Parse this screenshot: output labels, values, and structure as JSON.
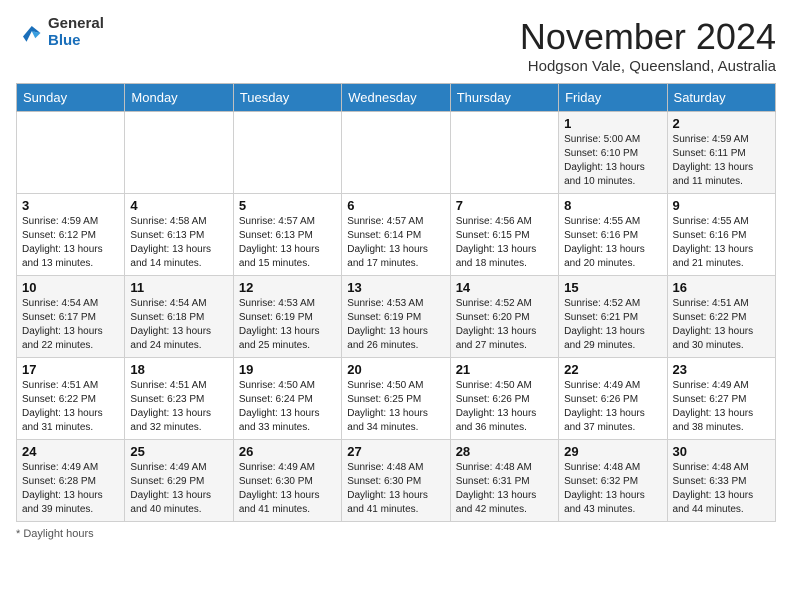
{
  "header": {
    "logo_line1": "General",
    "logo_line2": "Blue",
    "month_year": "November 2024",
    "location": "Hodgson Vale, Queensland, Australia"
  },
  "columns": [
    "Sunday",
    "Monday",
    "Tuesday",
    "Wednesday",
    "Thursday",
    "Friday",
    "Saturday"
  ],
  "weeks": [
    [
      {
        "day": "",
        "info": ""
      },
      {
        "day": "",
        "info": ""
      },
      {
        "day": "",
        "info": ""
      },
      {
        "day": "",
        "info": ""
      },
      {
        "day": "",
        "info": ""
      },
      {
        "day": "1",
        "info": "Sunrise: 5:00 AM\nSunset: 6:10 PM\nDaylight: 13 hours and 10 minutes."
      },
      {
        "day": "2",
        "info": "Sunrise: 4:59 AM\nSunset: 6:11 PM\nDaylight: 13 hours and 11 minutes."
      }
    ],
    [
      {
        "day": "3",
        "info": "Sunrise: 4:59 AM\nSunset: 6:12 PM\nDaylight: 13 hours and 13 minutes."
      },
      {
        "day": "4",
        "info": "Sunrise: 4:58 AM\nSunset: 6:13 PM\nDaylight: 13 hours and 14 minutes."
      },
      {
        "day": "5",
        "info": "Sunrise: 4:57 AM\nSunset: 6:13 PM\nDaylight: 13 hours and 15 minutes."
      },
      {
        "day": "6",
        "info": "Sunrise: 4:57 AM\nSunset: 6:14 PM\nDaylight: 13 hours and 17 minutes."
      },
      {
        "day": "7",
        "info": "Sunrise: 4:56 AM\nSunset: 6:15 PM\nDaylight: 13 hours and 18 minutes."
      },
      {
        "day": "8",
        "info": "Sunrise: 4:55 AM\nSunset: 6:16 PM\nDaylight: 13 hours and 20 minutes."
      },
      {
        "day": "9",
        "info": "Sunrise: 4:55 AM\nSunset: 6:16 PM\nDaylight: 13 hours and 21 minutes."
      }
    ],
    [
      {
        "day": "10",
        "info": "Sunrise: 4:54 AM\nSunset: 6:17 PM\nDaylight: 13 hours and 22 minutes."
      },
      {
        "day": "11",
        "info": "Sunrise: 4:54 AM\nSunset: 6:18 PM\nDaylight: 13 hours and 24 minutes."
      },
      {
        "day": "12",
        "info": "Sunrise: 4:53 AM\nSunset: 6:19 PM\nDaylight: 13 hours and 25 minutes."
      },
      {
        "day": "13",
        "info": "Sunrise: 4:53 AM\nSunset: 6:19 PM\nDaylight: 13 hours and 26 minutes."
      },
      {
        "day": "14",
        "info": "Sunrise: 4:52 AM\nSunset: 6:20 PM\nDaylight: 13 hours and 27 minutes."
      },
      {
        "day": "15",
        "info": "Sunrise: 4:52 AM\nSunset: 6:21 PM\nDaylight: 13 hours and 29 minutes."
      },
      {
        "day": "16",
        "info": "Sunrise: 4:51 AM\nSunset: 6:22 PM\nDaylight: 13 hours and 30 minutes."
      }
    ],
    [
      {
        "day": "17",
        "info": "Sunrise: 4:51 AM\nSunset: 6:22 PM\nDaylight: 13 hours and 31 minutes."
      },
      {
        "day": "18",
        "info": "Sunrise: 4:51 AM\nSunset: 6:23 PM\nDaylight: 13 hours and 32 minutes."
      },
      {
        "day": "19",
        "info": "Sunrise: 4:50 AM\nSunset: 6:24 PM\nDaylight: 13 hours and 33 minutes."
      },
      {
        "day": "20",
        "info": "Sunrise: 4:50 AM\nSunset: 6:25 PM\nDaylight: 13 hours and 34 minutes."
      },
      {
        "day": "21",
        "info": "Sunrise: 4:50 AM\nSunset: 6:26 PM\nDaylight: 13 hours and 36 minutes."
      },
      {
        "day": "22",
        "info": "Sunrise: 4:49 AM\nSunset: 6:26 PM\nDaylight: 13 hours and 37 minutes."
      },
      {
        "day": "23",
        "info": "Sunrise: 4:49 AM\nSunset: 6:27 PM\nDaylight: 13 hours and 38 minutes."
      }
    ],
    [
      {
        "day": "24",
        "info": "Sunrise: 4:49 AM\nSunset: 6:28 PM\nDaylight: 13 hours and 39 minutes."
      },
      {
        "day": "25",
        "info": "Sunrise: 4:49 AM\nSunset: 6:29 PM\nDaylight: 13 hours and 40 minutes."
      },
      {
        "day": "26",
        "info": "Sunrise: 4:49 AM\nSunset: 6:30 PM\nDaylight: 13 hours and 41 minutes."
      },
      {
        "day": "27",
        "info": "Sunrise: 4:48 AM\nSunset: 6:30 PM\nDaylight: 13 hours and 41 minutes."
      },
      {
        "day": "28",
        "info": "Sunrise: 4:48 AM\nSunset: 6:31 PM\nDaylight: 13 hours and 42 minutes."
      },
      {
        "day": "29",
        "info": "Sunrise: 4:48 AM\nSunset: 6:32 PM\nDaylight: 13 hours and 43 minutes."
      },
      {
        "day": "30",
        "info": "Sunrise: 4:48 AM\nSunset: 6:33 PM\nDaylight: 13 hours and 44 minutes."
      }
    ]
  ],
  "footer": {
    "note": "Daylight hours"
  }
}
